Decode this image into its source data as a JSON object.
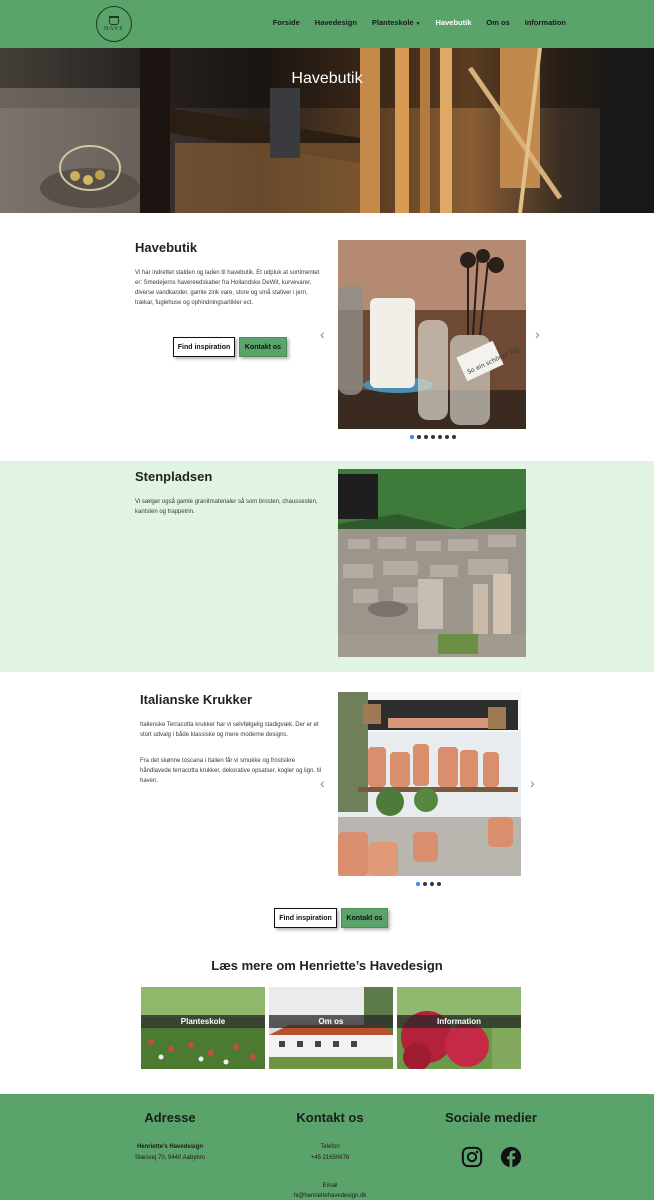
{
  "header": {
    "logo_text": "HAVE",
    "nav": [
      "Forside",
      "Havedesign",
      "Planteskole",
      "Havebutik",
      "Om os",
      "Information"
    ],
    "active_nav": "Havebutik"
  },
  "hero": {
    "title": "Havebutik"
  },
  "section1": {
    "title": "Havebutik",
    "text": "Vi har indrettet stalden og laden til havebutik. Et udpluk at sortimentet er: Smedejerns havereedskaber fra Hollandske DeWit, kurvevarer, diverse vandkander, gamle zink vare, store og små stativer i jern, trækar, fuglehuse og ophindningsartikler ect.",
    "btn_inspiration": "Find inspiration",
    "btn_contact": "Kontakt os",
    "tag_text": "So ein schöner Tag",
    "slides": 7,
    "active_slide": 0
  },
  "section2": {
    "title": "Stenpladsen",
    "text": "Vi sælger også gamle granitmaterialer så som brosten, chaussesten, kantsten og trappetrin."
  },
  "section3": {
    "title": "Italianske Krukker",
    "text1": "Italienske Terracotta krukker har vi selvfølgelig stadigvæk. Der er et stort udvalg i både klassiske og mere moderne designs.",
    "text2": "Fra det skønne toscana i Italien får vi smukke og frostsikre håndlavede terracotta krukker, dekorative opsatser, kogler og lign. til haven.",
    "slides": 4,
    "active_slide": 0
  },
  "cta": {
    "btn_inspiration": "Find inspiration",
    "btn_contact": "Kontakt os"
  },
  "readmore": {
    "title": "Læs mere om Henriette’s Havedesign",
    "cards": [
      "Planteskole",
      "Om os",
      "Information"
    ]
  },
  "footer": {
    "address_title": "Adresse",
    "company": "Henriette's Havedesign",
    "street": "Slæsvej 70, 9440 Aabybro",
    "contact_title": "Kontakt os",
    "phone_label": "Telefon",
    "phone": "+45 21650676",
    "email_label": "Email",
    "email": "hi@henriettehavedesign.dk",
    "social_title": "Sociale medier",
    "social_icons": [
      "instagram-icon",
      "facebook-icon"
    ]
  },
  "colors": {
    "brand_green": "#5aa36a",
    "light_green": "#e1f3e3",
    "arrow_green": "#4caf50",
    "active_dot": "#3b82f6"
  }
}
